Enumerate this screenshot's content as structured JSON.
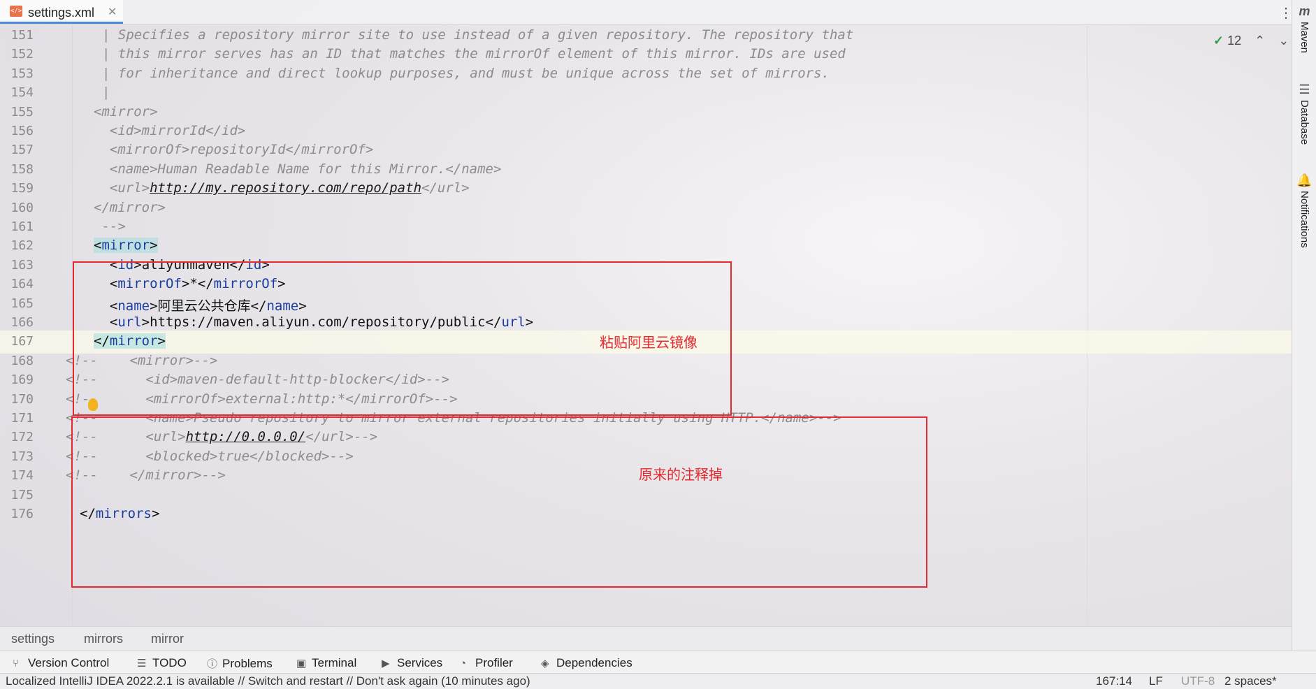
{
  "tab": {
    "label": "settings.xml",
    "icon": "xml-file-icon"
  },
  "right_panel": {
    "maven": "Maven",
    "database": "Database",
    "notifications": "Notifications"
  },
  "inspection": {
    "count": "12"
  },
  "lines": [
    {
      "num": "151",
      "indent": 0,
      "kind": "comment",
      "text": "| Specifies a repository mirror site to use instead of a given repository. The repository that"
    },
    {
      "num": "152",
      "indent": 0,
      "kind": "comment",
      "text": "| this mirror serves has an ID that matches the mirrorOf element of this mirror. IDs are used"
    },
    {
      "num": "153",
      "indent": 0,
      "kind": "comment",
      "text": "| for inheritance and direct lookup purposes, and must be unique across the set of mirrors."
    },
    {
      "num": "154",
      "indent": 0,
      "kind": "comment",
      "text": "|"
    },
    {
      "num": "155",
      "kind": "comment",
      "text": "<mirror>"
    },
    {
      "num": "156",
      "kind": "comment",
      "text": "  <id>mirrorId</id>"
    },
    {
      "num": "157",
      "kind": "comment",
      "text": "  <mirrorOf>repositoryId</mirrorOf>"
    },
    {
      "num": "158",
      "kind": "comment",
      "text": "  <name>Human Readable Name for this Mirror.</name>"
    },
    {
      "num": "159",
      "kind": "comment",
      "pre": "  <url>",
      "url": "http://my.repository.com/repo/path",
      "post": "</url>"
    },
    {
      "num": "160",
      "kind": "comment",
      "text": "</mirror>"
    },
    {
      "num": "161",
      "kind": "comment",
      "text": " -->"
    },
    {
      "num": "162",
      "kind": "tag",
      "pre": "<",
      "tag": "mirror",
      "post": ">"
    },
    {
      "num": "163",
      "kind": "element",
      "tag": "id",
      "value": "aliyunmaven"
    },
    {
      "num": "164",
      "kind": "element",
      "tag": "mirrorOf",
      "value": "*"
    },
    {
      "num": "165",
      "kind": "element",
      "tag": "name",
      "value": "阿里云公共仓库"
    },
    {
      "num": "166",
      "kind": "element",
      "tag": "url",
      "value": "https://maven.aliyun.com/repository/public"
    },
    {
      "num": "167",
      "kind": "tag",
      "pre": "</",
      "tag": "mirror",
      "post": ">"
    },
    {
      "num": "168",
      "kind": "comment",
      "text": "<!--    <mirror>-->"
    },
    {
      "num": "169",
      "kind": "comment",
      "text": "<!--      <id>maven-default-http-blocker</id>-->"
    },
    {
      "num": "170",
      "kind": "comment",
      "text": "<!--      <mirrorOf>external:http:*</mirrorOf>-->"
    },
    {
      "num": "171",
      "kind": "comment",
      "text": "<!--      <name>Pseudo repository to mirror external repositories initially using HTTP.</name>-->"
    },
    {
      "num": "172",
      "kind": "comment",
      "pre": "<!--      <url>",
      "url": "http://0.0.0.0/",
      "post": "</url>-->"
    },
    {
      "num": "173",
      "kind": "comment",
      "text": "<!--      <blocked>true</blocked>-->"
    },
    {
      "num": "174",
      "kind": "comment",
      "text": "<!--    </mirror>-->"
    },
    {
      "num": "175",
      "kind": "blank",
      "text": ""
    },
    {
      "num": "176",
      "kind": "tag",
      "pre": "</",
      "tag": "mirrors",
      "post": ">"
    }
  ],
  "annotations": {
    "paste": "粘贴阿里云镜像",
    "commented": "原来的注释掉"
  },
  "breadcrumb": [
    "settings",
    "mirrors",
    "mirror"
  ],
  "tool_windows": [
    {
      "label": "Version Control",
      "icon": "version-control-icon"
    },
    {
      "label": "TODO",
      "icon": "todo-icon"
    },
    {
      "label": "Problems",
      "icon": "problems-icon"
    },
    {
      "label": "Terminal",
      "icon": "terminal-icon"
    },
    {
      "label": "Services",
      "icon": "services-icon"
    },
    {
      "label": "Profiler",
      "icon": "profiler-icon"
    },
    {
      "label": "Dependencies",
      "icon": "dependencies-icon"
    }
  ],
  "status": {
    "message": "Localized IntelliJ IDEA 2022.2.1 is available // Switch and restart // Don't ask again (10 minutes ago)",
    "position": "167:14",
    "line_sep": "LF",
    "encoding": "UTF-8",
    "indent": "2 spaces*"
  }
}
